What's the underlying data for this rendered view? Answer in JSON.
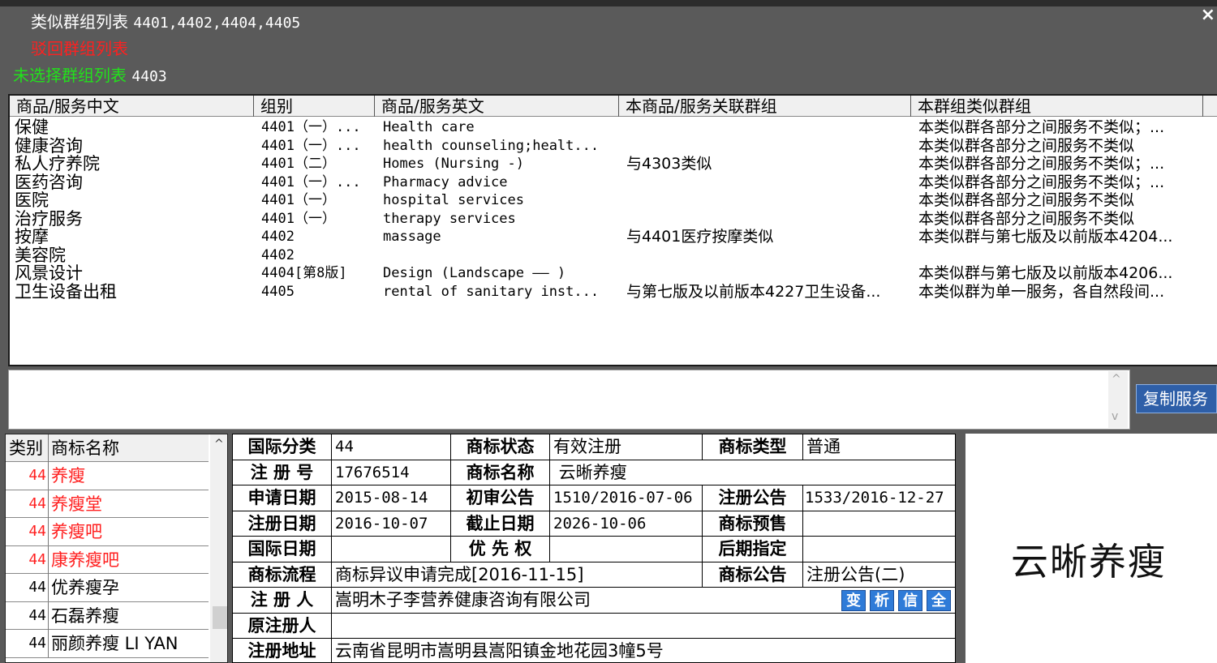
{
  "header": {
    "similar_label": "类似群组列表",
    "similar_groups": "4401,4402,4404,4405",
    "rejected_label": "驳回群组列表",
    "unselected_label": "未选择群组列表",
    "unselected_groups": "4403",
    "close_glyph": "×"
  },
  "services": {
    "columns": [
      "商品/服务中文",
      "组别",
      "商品/服务英文",
      "本商品/服务关联群组",
      "本群组类似群组"
    ],
    "rows": [
      {
        "cn": "保健",
        "group": "4401（一）...",
        "en": "Health care",
        "related": "",
        "similar": "本类似群各部分之间服务不类似；..."
      },
      {
        "cn": "健康咨询",
        "group": "4401（一）...",
        "en": "health counseling;healt...",
        "related": "",
        "similar": "本类似群各部分之间服务不类似"
      },
      {
        "cn": "私人疗养院",
        "group": "4401（二）",
        "en": "Homes (Nursing -)",
        "related": "与4303类似",
        "similar": "本类似群各部分之间服务不类似；..."
      },
      {
        "cn": "医药咨询",
        "group": "4401（一）...",
        "en": "Pharmacy advice",
        "related": "",
        "similar": "本类似群各部分之间服务不类似；..."
      },
      {
        "cn": "医院",
        "group": "4401（一）",
        "en": "hospital services",
        "related": "",
        "similar": "本类似群各部分之间服务不类似"
      },
      {
        "cn": "治疗服务",
        "group": "4401（一）",
        "en": "therapy services",
        "related": "",
        "similar": "本类似群各部分之间服务不类似"
      },
      {
        "cn": "按摩",
        "group": "4402",
        "en": "massage",
        "related": "与4401医疗按摩类似",
        "similar": "本类似群与第七版及以前版本4204..."
      },
      {
        "cn": "美容院",
        "group": "4402",
        "en": "",
        "related": "",
        "similar": ""
      },
      {
        "cn": "风景设计",
        "group": "4404[第8版]",
        "en": "Design (Landscape —— )",
        "related": "",
        "similar": "本类似群与第七版及以前版本4206..."
      },
      {
        "cn": "卫生设备出租",
        "group": "4405",
        "en": "rental of sanitary inst...",
        "related": "与第七版及以前版本4227卫生设备...",
        "similar": "本类似群为单一服务，各自然段间..."
      }
    ],
    "copy_button": "复制服务"
  },
  "trademark_list": {
    "col_class": "类别",
    "col_name": "商标名称",
    "items": [
      {
        "cls": "44",
        "name": "养瘦",
        "color": "#ff1e1e"
      },
      {
        "cls": "44",
        "name": "养瘦堂",
        "color": "#ff1e1e"
      },
      {
        "cls": "44",
        "name": "养瘦吧",
        "color": "#ff1e1e"
      },
      {
        "cls": "44",
        "name": "康养瘦吧",
        "color": "#ff1e1e"
      },
      {
        "cls": "44",
        "name": "优养瘦孕",
        "color": "#000000"
      },
      {
        "cls": "44",
        "name": "石磊养瘦",
        "color": "#000000"
      },
      {
        "cls": "44",
        "name": "丽颜养瘦 LI YAN",
        "color": "#000000"
      }
    ]
  },
  "detail": {
    "intl_class_label": "国际分类",
    "intl_class": "44",
    "status_label": "商标状态",
    "status": "有效注册",
    "type_label": "商标类型",
    "type": "普通",
    "reg_no_label": "注 册 号",
    "reg_no": "17676514",
    "name_label": "商标名称",
    "name": " 云晰养瘦",
    "apply_date_label": "申请日期",
    "apply_date": "2015-08-14",
    "prelim_label": "初审公告",
    "prelim": "1510/2016-07-06",
    "reg_notice_label": "注册公告",
    "reg_notice": "1533/2016-12-27",
    "reg_date_label": "注册日期",
    "reg_date": "2016-10-07",
    "expiry_label": "截止日期",
    "expiry": "2026-10-06",
    "presale_label": "商标预售",
    "presale": "",
    "intl_date_label": "国际日期",
    "intl_date": "",
    "priority_label": "优 先 权",
    "priority": "",
    "later_label": "后期指定",
    "later": "",
    "process_label": "商标流程",
    "process": "商标异议申请完成[2016-11-15]",
    "notice_label": "商标公告",
    "notice": "注册公告(二)",
    "registrant_label": "注 册 人",
    "registrant": "嵩明木子李营养健康咨询有限公司",
    "orig_registrant_label": "原注册人",
    "orig_registrant": "",
    "address_label": "注册地址",
    "address": "云南省昆明市嵩明县嵩阳镇金地花园3幢5号",
    "mini_buttons": [
      "变",
      "析",
      "信",
      "全"
    ]
  },
  "logo": {
    "text": "云晰养瘦"
  }
}
